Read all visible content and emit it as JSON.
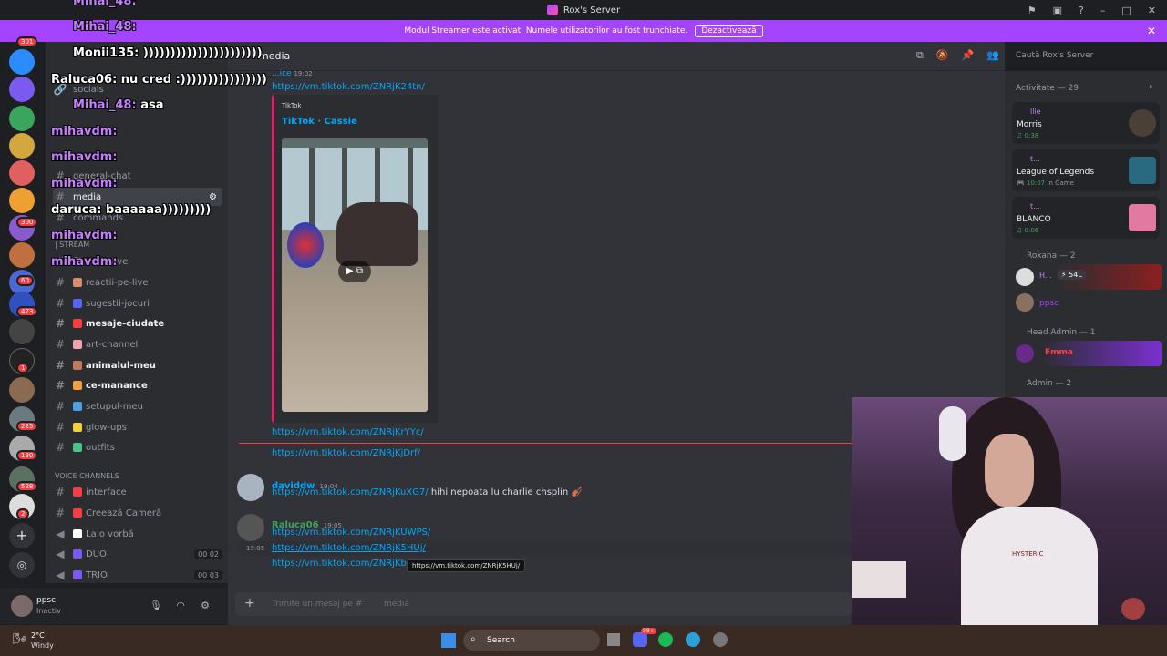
{
  "window": {
    "title": "Rox's Server"
  },
  "banner": {
    "text": "Modul Streamer este activat. Numele utilizatorilor au fost trunchiate.",
    "button": "Dezactivează"
  },
  "chat_overlay": [
    {
      "name": "Mihai_48:",
      "msg": "",
      "color": "#c77dff"
    },
    {
      "name": "Mihai_48:",
      "msg": "",
      "color": "#c77dff"
    },
    {
      "name": "Monii135:",
      "msg": "))))))))))))))))))))))",
      "color": "#ffffff"
    },
    {
      "name": "Raluca06:",
      "msg": "nu cred :))))))))))))))))",
      "color": "#ffffff"
    },
    {
      "name": "Mihai_48:",
      "msg": "asa",
      "color": "#c77dff"
    },
    {
      "name": "mihavdm:",
      "msg": "",
      "color": "#c77dff"
    },
    {
      "name": "mihavdm:",
      "msg": "",
      "color": "#c77dff"
    },
    {
      "name": "mihavdm:",
      "msg": "",
      "color": "#c77dff"
    },
    {
      "name": "daruca:",
      "msg": "baaaaaa)))))))))",
      "color": "#ffffff"
    },
    {
      "name": "mihavdm:",
      "msg": "",
      "color": "#c77dff"
    },
    {
      "name": "mihavdm:",
      "msg": "",
      "color": "#c77dff"
    }
  ],
  "guild_badges": [
    "301",
    "300",
    "60",
    "473",
    "1",
    "225",
    "130",
    "528",
    "2"
  ],
  "channels": {
    "top": [
      {
        "name": "socials",
        "style": ""
      },
      {
        "name": "general-chat",
        "style": ""
      },
      {
        "name": "media",
        "style": "sel"
      },
      {
        "name": "commands",
        "style": ""
      }
    ],
    "stream_category": "| STREAM",
    "stream": [
      {
        "name": "de-la-live",
        "style": "",
        "emo": "#8a6d5a"
      },
      {
        "name": "reactii-pe-live",
        "style": "",
        "emo": "#d98c6c"
      },
      {
        "name": "sugestii-jocuri",
        "style": "",
        "emo": "#5865f2"
      },
      {
        "name": "mesaje-ciudate",
        "style": "bold",
        "emo": "#f23f43"
      },
      {
        "name": "art-channel",
        "style": "",
        "emo": "#f0a0b0"
      },
      {
        "name": "animalul-meu",
        "style": "bold",
        "emo": "#c07a5a"
      },
      {
        "name": "ce-manance",
        "style": "bold",
        "emo": "#f0a040"
      },
      {
        "name": "setupul-meu",
        "style": "",
        "emo": "#4aa0e0"
      },
      {
        "name": "glow-ups",
        "style": "",
        "emo": "#f0d040"
      },
      {
        "name": "outfits",
        "style": "",
        "emo": "#4ac08a"
      }
    ],
    "voice_category": "VOICE CHANNELS",
    "voice": [
      {
        "name": "interface",
        "count": "",
        "emo": "#f23f43"
      },
      {
        "name": "Creează Cameră",
        "count": "",
        "emo": "#f23f43"
      },
      {
        "name": "La o vorbă",
        "count": "",
        "emo": "#ffffff"
      },
      {
        "name": "DUO",
        "count": "00 02",
        "emo": "#7a5af0"
      },
      {
        "name": "TRIO",
        "count": "00 03",
        "emo": "#7a5af0"
      }
    ]
  },
  "user": {
    "name": "ppsc",
    "status": "Inactiv"
  },
  "chat": {
    "channel": "media",
    "search_placeholder": "Caută Rox's Server",
    "top_user": "...ice",
    "top_time": "19:02",
    "link1": "https://vm.tiktok.com/ZNRjK24tn/",
    "embed_provider": "TikTok",
    "embed_title": "TikTok · Cassie",
    "link2": "https://vm.tiktok.com/ZNRjKrYYc/",
    "link3": "https://vm.tiktok.com/ZNRjKjDrf/",
    "msg1_user": "daviddw",
    "msg1_time": "19:04",
    "msg1_link": "https://vm.tiktok.com/ZNRjKuXG7/",
    "msg1_text": "hihi nepoata lu charlie chsplin",
    "msg2_user": "Raluca06",
    "msg2_time": "19:05",
    "msg2_link1": "https://vm.tiktok.com/ZNRjKUWPS/",
    "msg2_time2": "19:05",
    "msg2_link2": "https://vm.tiktok.com/ZNRjK5HUj/",
    "msg2_link3": "https://vm.tiktok.com/ZNRjKb",
    "tooltip": "https://vm.tiktok.com/ZNRjK5HUj/",
    "input_placeholder": "Trimite un mesaj pe #",
    "input_channel": "media"
  },
  "members": {
    "activity_header": "Activitate — 29",
    "activities": [
      {
        "user": "llie",
        "title": "Morris",
        "meta": "0:38"
      },
      {
        "user": "t...",
        "title": "League of Legends",
        "meta": "10:07",
        "extra": "In Game"
      },
      {
        "user": "t...",
        "title": "BLANCO",
        "meta": "0:06"
      }
    ],
    "roxana_header": "Roxana — 2",
    "member1_tag": "54L",
    "member1_name": "H...",
    "member2_name": "ppsc",
    "head_admin_header": "Head Admin — 1",
    "head_admin_name": "Emma",
    "admin_header": "Admin — 2"
  },
  "taskbar": {
    "weather_temp": "2°C",
    "weather_desc": "Windy",
    "search": "Search",
    "badge": "99+"
  },
  "webcam": {
    "shirt_text": "HYSTERIC"
  }
}
